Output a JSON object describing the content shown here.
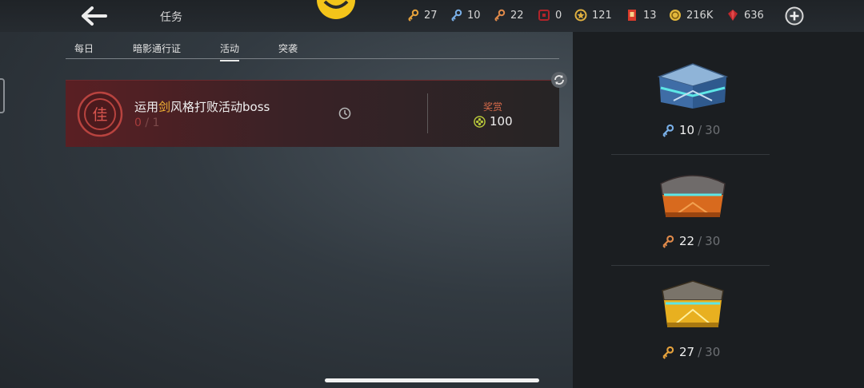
{
  "header": {
    "title": "任务",
    "resources": [
      {
        "name": "gold-key",
        "value": "27",
        "color": "#e6a23c"
      },
      {
        "name": "blue-key",
        "value": "10",
        "color": "#7ab0e8"
      },
      {
        "name": "bronze-key",
        "value": "22",
        "color": "#e08a4a"
      },
      {
        "name": "red-ticket",
        "value": "0",
        "color": "#b0242a"
      },
      {
        "name": "star-coin",
        "value": "121",
        "color": "#e0b040"
      },
      {
        "name": "red-scroll",
        "value": "13",
        "color": "#d83a2a"
      },
      {
        "name": "gold-coin",
        "value": "216K",
        "color": "#e2b73c"
      },
      {
        "name": "red-gem",
        "value": "636",
        "color": "#c0282c"
      }
    ]
  },
  "tabs": [
    {
      "label": "每日",
      "active": false
    },
    {
      "label": "暗影通行证",
      "active": false
    },
    {
      "label": "活动",
      "active": true
    },
    {
      "label": "突袭",
      "active": false
    }
  ],
  "task": {
    "name_prefix": "运用",
    "name_highlight": "剑",
    "name_suffix": "风格打败活动boss",
    "progress_current": "0",
    "progress_sep": "/",
    "progress_total": "1",
    "reward_label": "奖赏",
    "reward_value": "100"
  },
  "chests": [
    {
      "type": "blue",
      "have": "10",
      "need": "30",
      "key_color": "#7ab0e8"
    },
    {
      "type": "bronze",
      "have": "22",
      "need": "30",
      "key_color": "#e08a4a"
    },
    {
      "type": "gold",
      "have": "27",
      "need": "30",
      "key_color": "#e6a23c"
    }
  ],
  "slash": "/"
}
